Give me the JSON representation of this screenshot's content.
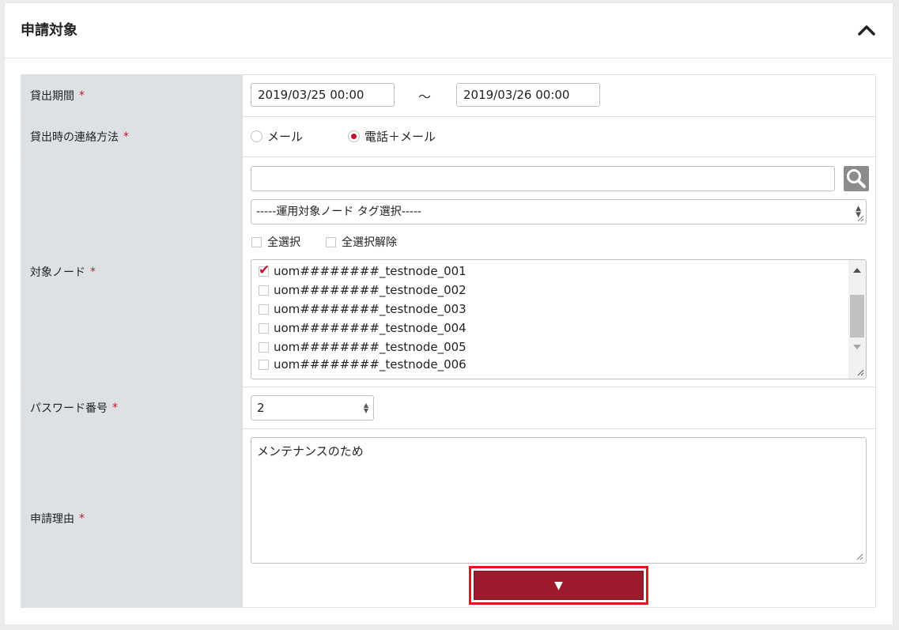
{
  "panel": {
    "title": "申請対象",
    "collapse_icon": "chevron-up-icon"
  },
  "required_mark": "*",
  "loan_period": {
    "label": "貸出期間",
    "start": "2019/03/25 00:00",
    "separator": "～",
    "end": "2019/03/26 00:00"
  },
  "contact_method": {
    "label": "貸出時の連絡方法",
    "options": [
      {
        "label": "メール",
        "checked": false
      },
      {
        "label": "電話＋メール",
        "checked": true
      }
    ]
  },
  "target_nodes": {
    "label": "対象ノード",
    "search_value": "",
    "search_icon": "magnifier-icon",
    "tag_select": "-----運用対象ノード タグ選択-----",
    "select_all": "全選択",
    "deselect_all": "全選択解除",
    "items": [
      {
        "label": "uom########_testnode_001",
        "checked": true
      },
      {
        "label": "uom########_testnode_002",
        "checked": false
      },
      {
        "label": "uom########_testnode_003",
        "checked": false
      },
      {
        "label": "uom########_testnode_004",
        "checked": false
      },
      {
        "label": "uom########_testnode_005",
        "checked": false
      },
      {
        "label": "uom########_testnode_006",
        "checked": false
      }
    ]
  },
  "password_number": {
    "label": "パスワード番号",
    "value": "2"
  },
  "reason": {
    "label": "申請理由",
    "value": "メンテナンスのため"
  },
  "submit": {
    "label": "▼",
    "icon": "triangle-down-icon"
  },
  "colors": {
    "accent": "#c8102e",
    "button": "#9c1c2e",
    "highlight": "#e3141b",
    "label_bg": "#dde1e4"
  }
}
